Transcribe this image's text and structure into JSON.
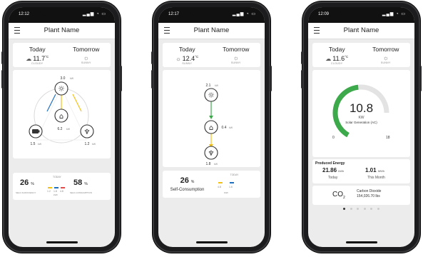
{
  "screens": [
    {
      "status_time": "12:12",
      "header_title": "Plant Name",
      "today_label": "Today",
      "today_temp": "11.7",
      "today_unit": "°C",
      "today_condition": "CLOUDY",
      "tomorrow_label": "Tomorrow",
      "tomorrow_condition": "SUNNY",
      "flow": {
        "solar_value": "3.0",
        "solar_unit": "kW",
        "home_value": "6.2",
        "home_unit": "kW",
        "battery_value": "1.5",
        "battery_unit": "kW",
        "grid_value": "1.2",
        "grid_unit": "kW"
      },
      "bottom": {
        "left_pct": "26",
        "left_pct_unit": "%",
        "left_label": "SELF-SUFFICIENCY",
        "right_pct": "58",
        "right_pct_unit": "%",
        "right_label": "SELF-CONSUMPTION",
        "today_label": "TODAY",
        "mini_values": [
          "1.2",
          "1.8",
          "4.8"
        ],
        "mini_unit": "kWh"
      }
    },
    {
      "status_time": "12:17",
      "header_title": "Plant Name",
      "today_label": "Today",
      "today_temp": "12.4",
      "today_unit": "°C",
      "today_condition": "SUNNY",
      "tomorrow_label": "Tomorrow",
      "tomorrow_condition": "SUNNY",
      "flow": {
        "solar_value": "2.1",
        "solar_unit": "kW",
        "home_value": "0.4",
        "home_unit": "kW",
        "grid_value": "1.8",
        "grid_unit": "kW"
      },
      "bottom": {
        "left_pct": "26",
        "left_pct_unit": "%",
        "left_label": "Self-Consumption",
        "today_label": "TODAY",
        "mini_values": [
          "4.8",
          "1.6"
        ],
        "mini_unit": "kWh"
      }
    },
    {
      "status_time": "12:09",
      "header_title": "Plant Name",
      "today_label": "Today",
      "today_temp": "11.6",
      "today_unit": "°C",
      "today_condition": "CLOUDY",
      "tomorrow_label": "Tomorrow",
      "tomorrow_condition": "SUNNY",
      "gauge": {
        "value": "10.8",
        "unit": "KW",
        "label": "Solar Generation (AC)",
        "min": "0",
        "max": "18",
        "level": 0.6
      },
      "energy": {
        "title": "Produced Energy",
        "today_value": "21.86",
        "today_unit": "kWh",
        "today_label": "Today",
        "month_value": "1.01",
        "month_unit": "MWh",
        "month_label": "This Month"
      },
      "co2": {
        "symbol": "CO",
        "subscript": "2",
        "title": "Carbon Dioxide",
        "value": "154,026.70 lbs"
      }
    }
  ],
  "colors": {
    "accent_green": "#3caa4b",
    "flow_yellow": "#f2c21b",
    "flow_blue": "#1f6fbf",
    "gauge_track": "#e3e3e3"
  }
}
